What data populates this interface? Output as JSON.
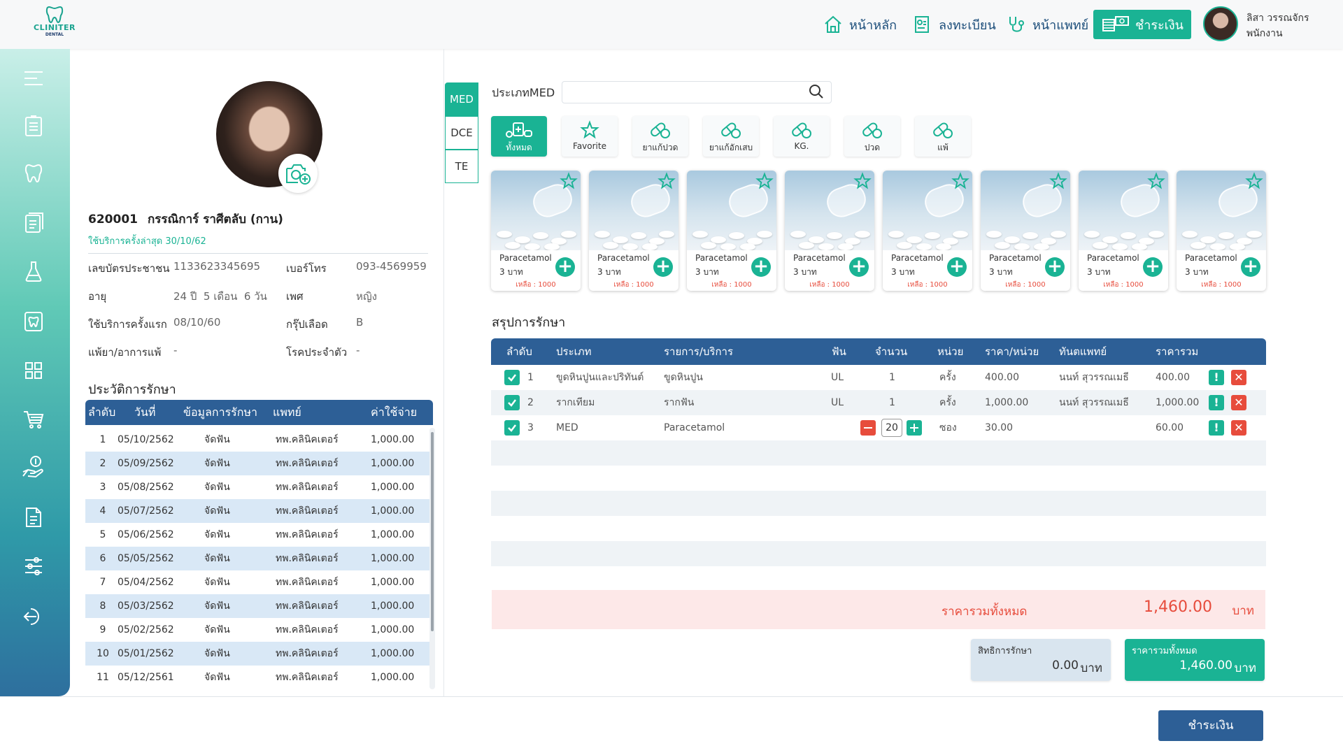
{
  "header": {
    "logo": {
      "text": "CLINITER",
      "sub": "DENTAL"
    },
    "nav": {
      "home": "หน้าหลัก",
      "register": "ลงทะเบียน",
      "doctor": "หน้าแพทย์",
      "payment": "ชำระเงิน"
    },
    "user": {
      "name": "ลิสา วรรณจักร",
      "role": "พนักงาน"
    }
  },
  "sidebar": {
    "icons": [
      "menu-icon",
      "clipboard-icon",
      "tooth-icon",
      "records-icon",
      "flask-icon",
      "dental-chart-icon",
      "grid-icon",
      "cart-icon",
      "money-hand-icon",
      "document-icon",
      "sliders-icon",
      "logout-icon"
    ]
  },
  "patient": {
    "hn": "620001",
    "name": "กรรณิการ์ ราศีตลับ (กาน)",
    "last_visit": "ใช้บริการครั้งล่าสุด 30/10/62",
    "fields": [
      {
        "label": "เลขบัตรประชาชน",
        "value": "1133623345695"
      },
      {
        "label": "เบอร์โทร",
        "value": "093-4569959"
      },
      {
        "label": "อายุ",
        "value": "24 ปี  5 เดือน  6 วัน"
      },
      {
        "label": "เพศ",
        "value": "หญิง"
      },
      {
        "label": "ใช้บริการครั้งแรก",
        "value": "08/10/60"
      },
      {
        "label": "กรุ๊ปเลือด",
        "value": "B"
      },
      {
        "label": "แพ้ยา/อาการแพ้",
        "value": "-"
      },
      {
        "label": "โรคประจำตัว",
        "value": "-"
      }
    ]
  },
  "history": {
    "title": "ประวัติการรักษา",
    "columns": [
      "ลำดับ",
      "วันที่",
      "ข้อมูลการรักษา",
      "แพทย์",
      "ค่าใช้จ่าย"
    ],
    "rows": [
      [
        "1",
        "05/10/2562",
        "จัดฟัน",
        "ทพ.คลินิคเตอร์",
        "1,000.00"
      ],
      [
        "2",
        "05/09/2562",
        "จัดฟัน",
        "ทพ.คลินิคเตอร์",
        "1,000.00"
      ],
      [
        "3",
        "05/08/2562",
        "จัดฟัน",
        "ทพ.คลินิคเตอร์",
        "1,000.00"
      ],
      [
        "4",
        "05/07/2562",
        "จัดฟัน",
        "ทพ.คลินิคเตอร์",
        "1,000.00"
      ],
      [
        "5",
        "05/06/2562",
        "จัดฟัน",
        "ทพ.คลินิคเตอร์",
        "1,000.00"
      ],
      [
        "6",
        "05/05/2562",
        "จัดฟัน",
        "ทพ.คลินิคเตอร์",
        "1,000.00"
      ],
      [
        "7",
        "05/04/2562",
        "จัดฟัน",
        "ทพ.คลินิคเตอร์",
        "1,000.00"
      ],
      [
        "8",
        "05/03/2562",
        "จัดฟัน",
        "ทพ.คลินิคเตอร์",
        "1,000.00"
      ],
      [
        "9",
        "05/02/2562",
        "จัดฟัน",
        "ทพ.คลินิคเตอร์",
        "1,000.00"
      ],
      [
        "10",
        "05/01/2562",
        "จัดฟัน",
        "ทพ.คลินิคเตอร์",
        "1,000.00"
      ],
      [
        "11",
        "05/12/2561",
        "จัดฟัน",
        "ทพ.คลินิคเตอร์",
        "1,000.00"
      ]
    ]
  },
  "tabs": [
    "MED",
    "DCE",
    "TE"
  ],
  "search": {
    "label": "ประเภทMED",
    "value": "",
    "placeholder": ""
  },
  "categories": [
    {
      "label": "ทั้งหมด",
      "icon": "all-meds-icon"
    },
    {
      "label": "Favorite",
      "icon": "star-icon"
    },
    {
      "label": "ยาแก้ปวด",
      "icon": "pill-icon"
    },
    {
      "label": "ยาแก้อักเสบ",
      "icon": "pill-icon"
    },
    {
      "label": "KG.",
      "icon": "pill-icon"
    },
    {
      "label": "ปวด",
      "icon": "pill-icon"
    },
    {
      "label": "แพ้",
      "icon": "pill-icon"
    }
  ],
  "products": [
    {
      "name": "Paracetamol",
      "price": "3 บาท",
      "stock": "เหลือ : 1000"
    },
    {
      "name": "Paracetamol",
      "price": "3 บาท",
      "stock": "เหลือ : 1000"
    },
    {
      "name": "Paracetamol",
      "price": "3 บาท",
      "stock": "เหลือ : 1000"
    },
    {
      "name": "Paracetamol",
      "price": "3 บาท",
      "stock": "เหลือ : 1000"
    },
    {
      "name": "Paracetamol",
      "price": "3 บาท",
      "stock": "เหลือ : 1000"
    },
    {
      "name": "Paracetamol",
      "price": "3 บาท",
      "stock": "เหลือ : 1000"
    },
    {
      "name": "Paracetamol",
      "price": "3 บาท",
      "stock": "เหลือ : 1000"
    },
    {
      "name": "Paracetamol",
      "price": "3 บาท",
      "stock": "เหลือ : 1000"
    }
  ],
  "summary": {
    "title": "สรุปการรักษา",
    "columns": [
      "ลำดับ",
      "ประเภท",
      "รายการ/บริการ",
      "ฟัน",
      "จำนวน",
      "หน่วย",
      "ราคา/หน่วย",
      "ทันตแพทย์",
      "ราคารวม"
    ],
    "rows": [
      {
        "no": "1",
        "type": "ขูดหินปูนและปริทันต์",
        "item": "ขูดหินปูน",
        "tooth": "UL",
        "qty": "1",
        "unit": "ครั้ง",
        "price": "400.00",
        "dentist": "นนท์ สุวรรณเมธี",
        "total": "400.00"
      },
      {
        "no": "2",
        "type": "รากเทียม",
        "item": "รากฟัน",
        "tooth": "UL",
        "qty": "1",
        "unit": "ครั้ง",
        "price": "1,000.00",
        "dentist": "นนท์ สุวรรณเมธี",
        "total": "1,000.00"
      },
      {
        "no": "3",
        "type": "MED",
        "item": "Paracetamol",
        "tooth": "",
        "qty": "20",
        "unit": "ซอง",
        "price": "30.00",
        "dentist": "",
        "total": "60.00"
      }
    ],
    "grand_label": "ราคารวมทั้งหมด",
    "grand_value": "1,460.00",
    "currency": "บาท",
    "rights_label": "สิทธิการรักษา",
    "rights_value": "0.00",
    "total_label": "ราคารวมทั้งหมด",
    "total_value": "1,460.00"
  },
  "footer": {
    "pay_button": "ชำระเงิน"
  },
  "colors": {
    "accent": "#1ab394",
    "primary": "#2d5f96",
    "danger": "#e74c3c"
  }
}
